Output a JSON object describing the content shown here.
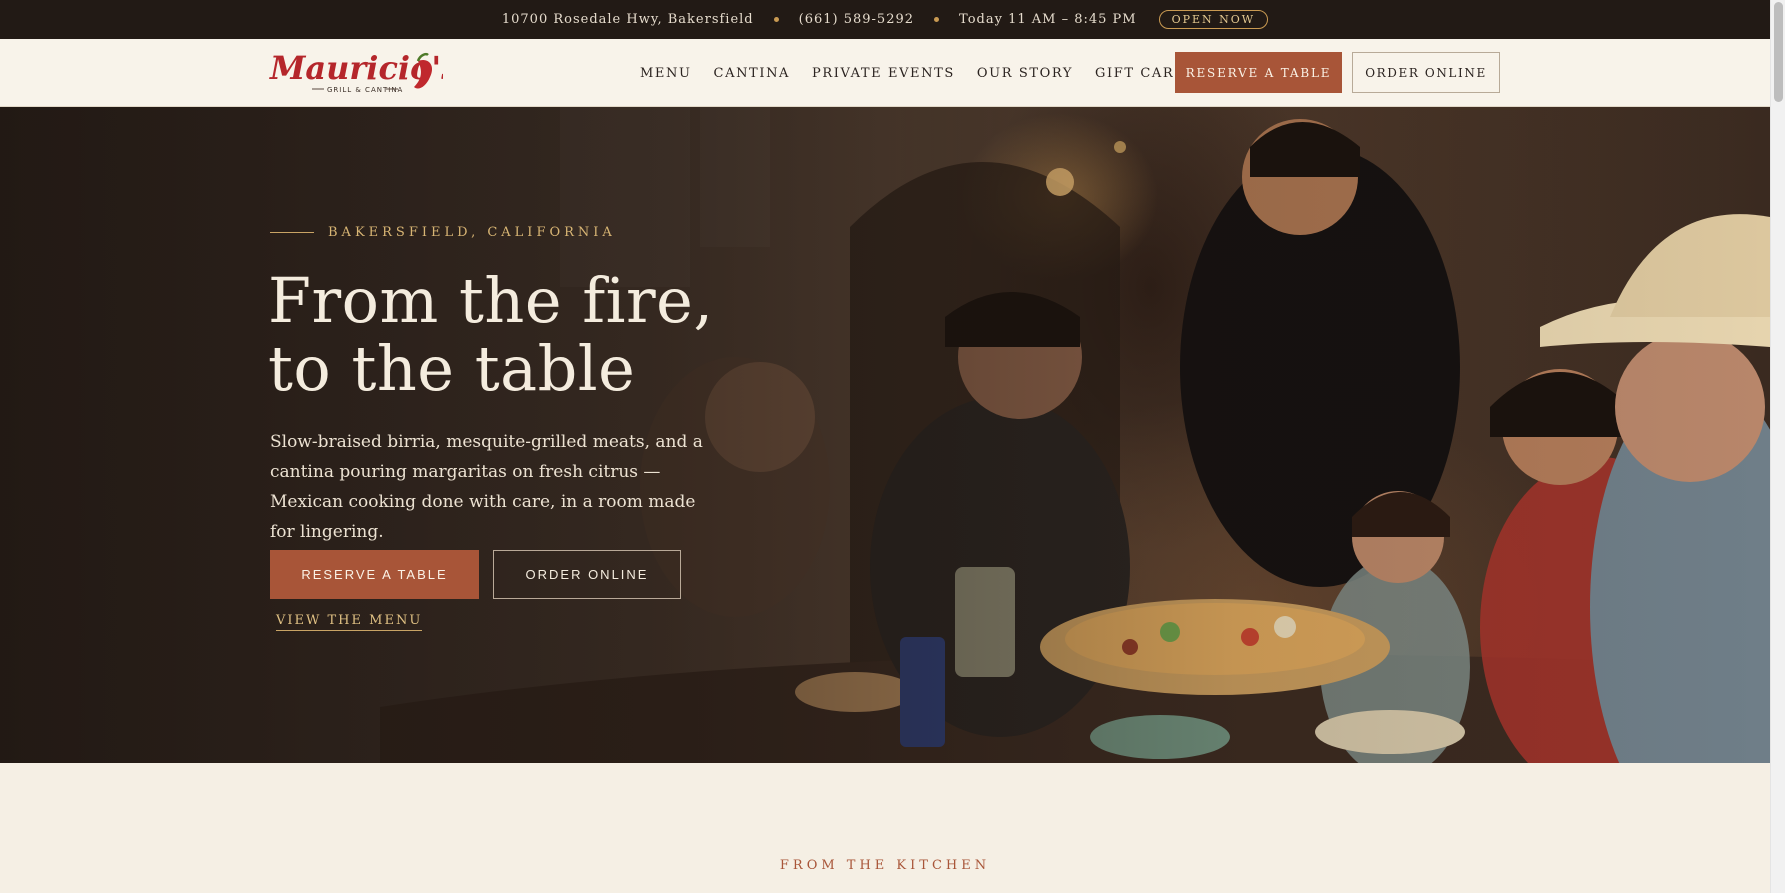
{
  "topbar": {
    "address": "10700 Rosedale Hwy, Bakersfield",
    "phone": "(661) 589-5292",
    "hours": "Today 11 AM – 8:45 PM",
    "status_badge": "OPEN NOW"
  },
  "brand": {
    "logo_name": "Mauricio's",
    "logo_tagline": "GRILL & CANTINA",
    "accent_color": "#a85538",
    "dark_color": "#221a15",
    "gold_color": "#c99a52"
  },
  "nav": {
    "links": [
      "MENU",
      "CANTINA",
      "PRIVATE EVENTS",
      "OUR STORY",
      "GIFT CARDS"
    ],
    "reserve_label": "RESERVE A TABLE",
    "order_label": "ORDER ONLINE"
  },
  "hero": {
    "eyebrow": "BAKERSFIELD, CALIFORNIA",
    "title_line1": "From the fire,",
    "title_line2": "to the table",
    "body": "Slow-braised birria, mesquite-grilled meats, and a cantina pouring margaritas on fresh citrus — Mexican cooking done with care, in a room made for lingering.",
    "reserve_label": "RESERVE A TABLE",
    "order_label": "ORDER ONLINE",
    "menu_link": "VIEW THE MENU"
  },
  "section": {
    "eyebrow": "FROM THE KITCHEN"
  },
  "icons": [
    "chili-pepper-icon",
    "status-dot-icon"
  ]
}
